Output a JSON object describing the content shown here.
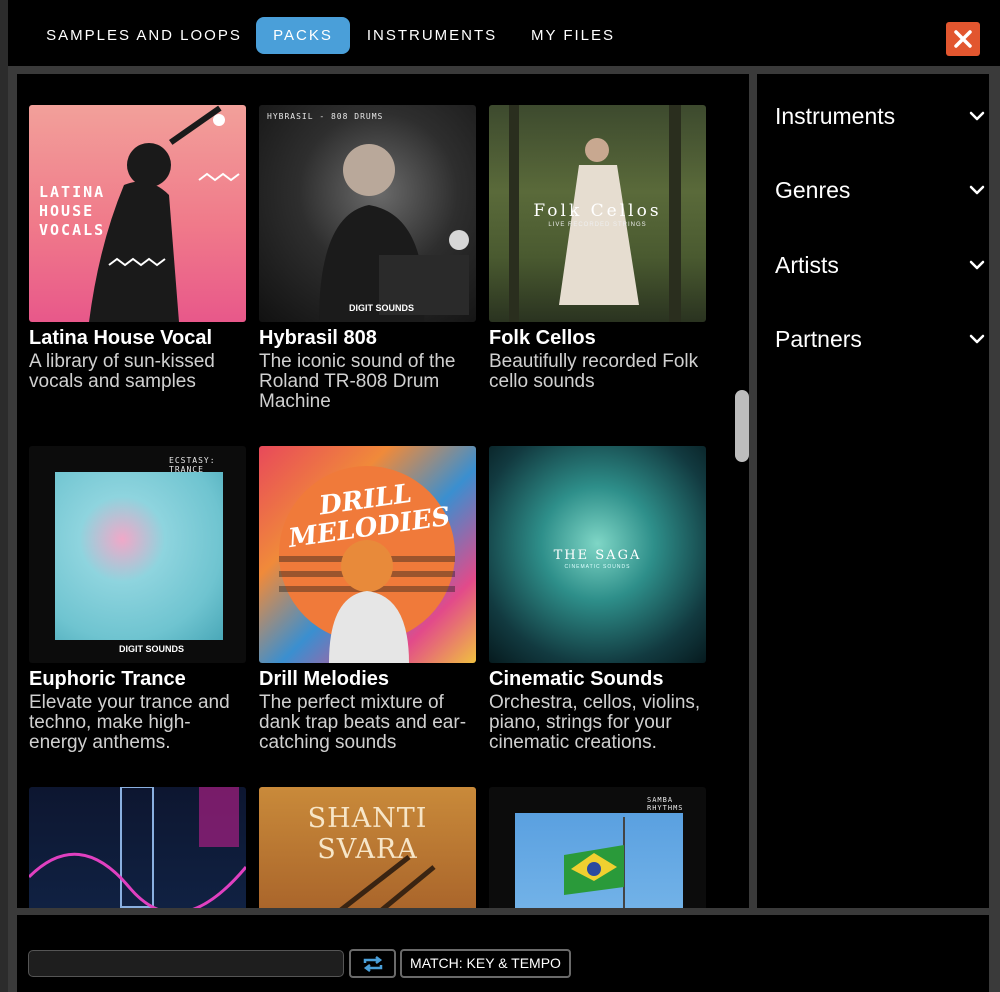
{
  "tabs": [
    {
      "label": "SAMPLES AND LOOPS",
      "active": false
    },
    {
      "label": "PACKS",
      "active": true
    },
    {
      "label": "INSTRUMENTS",
      "active": false
    },
    {
      "label": "MY FILES",
      "active": false
    }
  ],
  "close_icon": "close-x-icon",
  "colors": {
    "active_tab": "#4a9fd9",
    "close_button": "#e2562f",
    "background": "#000000",
    "frame": "#2c2c2c"
  },
  "packs": [
    {
      "title": "Latina House Vocal",
      "description": "A library of sun-kissed vocals and samples",
      "art_text": "LATINA HOUSE VOCALS"
    },
    {
      "title": "Hybrasil 808",
      "description": "The iconic sound of the Roland TR-808 Drum Machine",
      "art_text": "HYBRASIL - 808 DRUMS",
      "art_logo": "DIGIT SOUNDS"
    },
    {
      "title": "Folk Cellos",
      "description": "Beautifully recorded Folk cello sounds",
      "art_text": "Folk Cellos",
      "art_subtext": "LIVE RECORDED STRINGS"
    },
    {
      "title": "Euphoric Trance",
      "description": "Elevate your trance and techno, make high-energy anthems.",
      "art_text": "ECSTASY: TRANCE",
      "art_logo": "DIGIT SOUNDS"
    },
    {
      "title": "Drill Melodies",
      "description": "The perfect mixture of dank trap beats and ear-catching sounds",
      "art_text": "DRILL MELODIES"
    },
    {
      "title": "Cinematic Sounds",
      "description": "Orchestra, cellos, violins, piano, strings for your cinematic creations.",
      "art_text": "THE SAGA",
      "art_subtext": "CINEMATIC SOUNDS"
    },
    {
      "title": "",
      "description": "",
      "art_text": ""
    },
    {
      "title": "",
      "description": "",
      "art_text": "SHANTI SVARA"
    },
    {
      "title": "",
      "description": "",
      "art_text": "SAMBA RHYTHMS"
    }
  ],
  "filters": [
    {
      "label": "Instruments",
      "icon": "chevron-down-icon"
    },
    {
      "label": "Genres",
      "icon": "chevron-down-icon"
    },
    {
      "label": "Artists",
      "icon": "chevron-down-icon"
    },
    {
      "label": "Partners",
      "icon": "chevron-down-icon"
    }
  ],
  "bottom": {
    "search_value": "",
    "loop_icon": "repeat-icon",
    "match_label": "MATCH: KEY & TEMPO"
  }
}
